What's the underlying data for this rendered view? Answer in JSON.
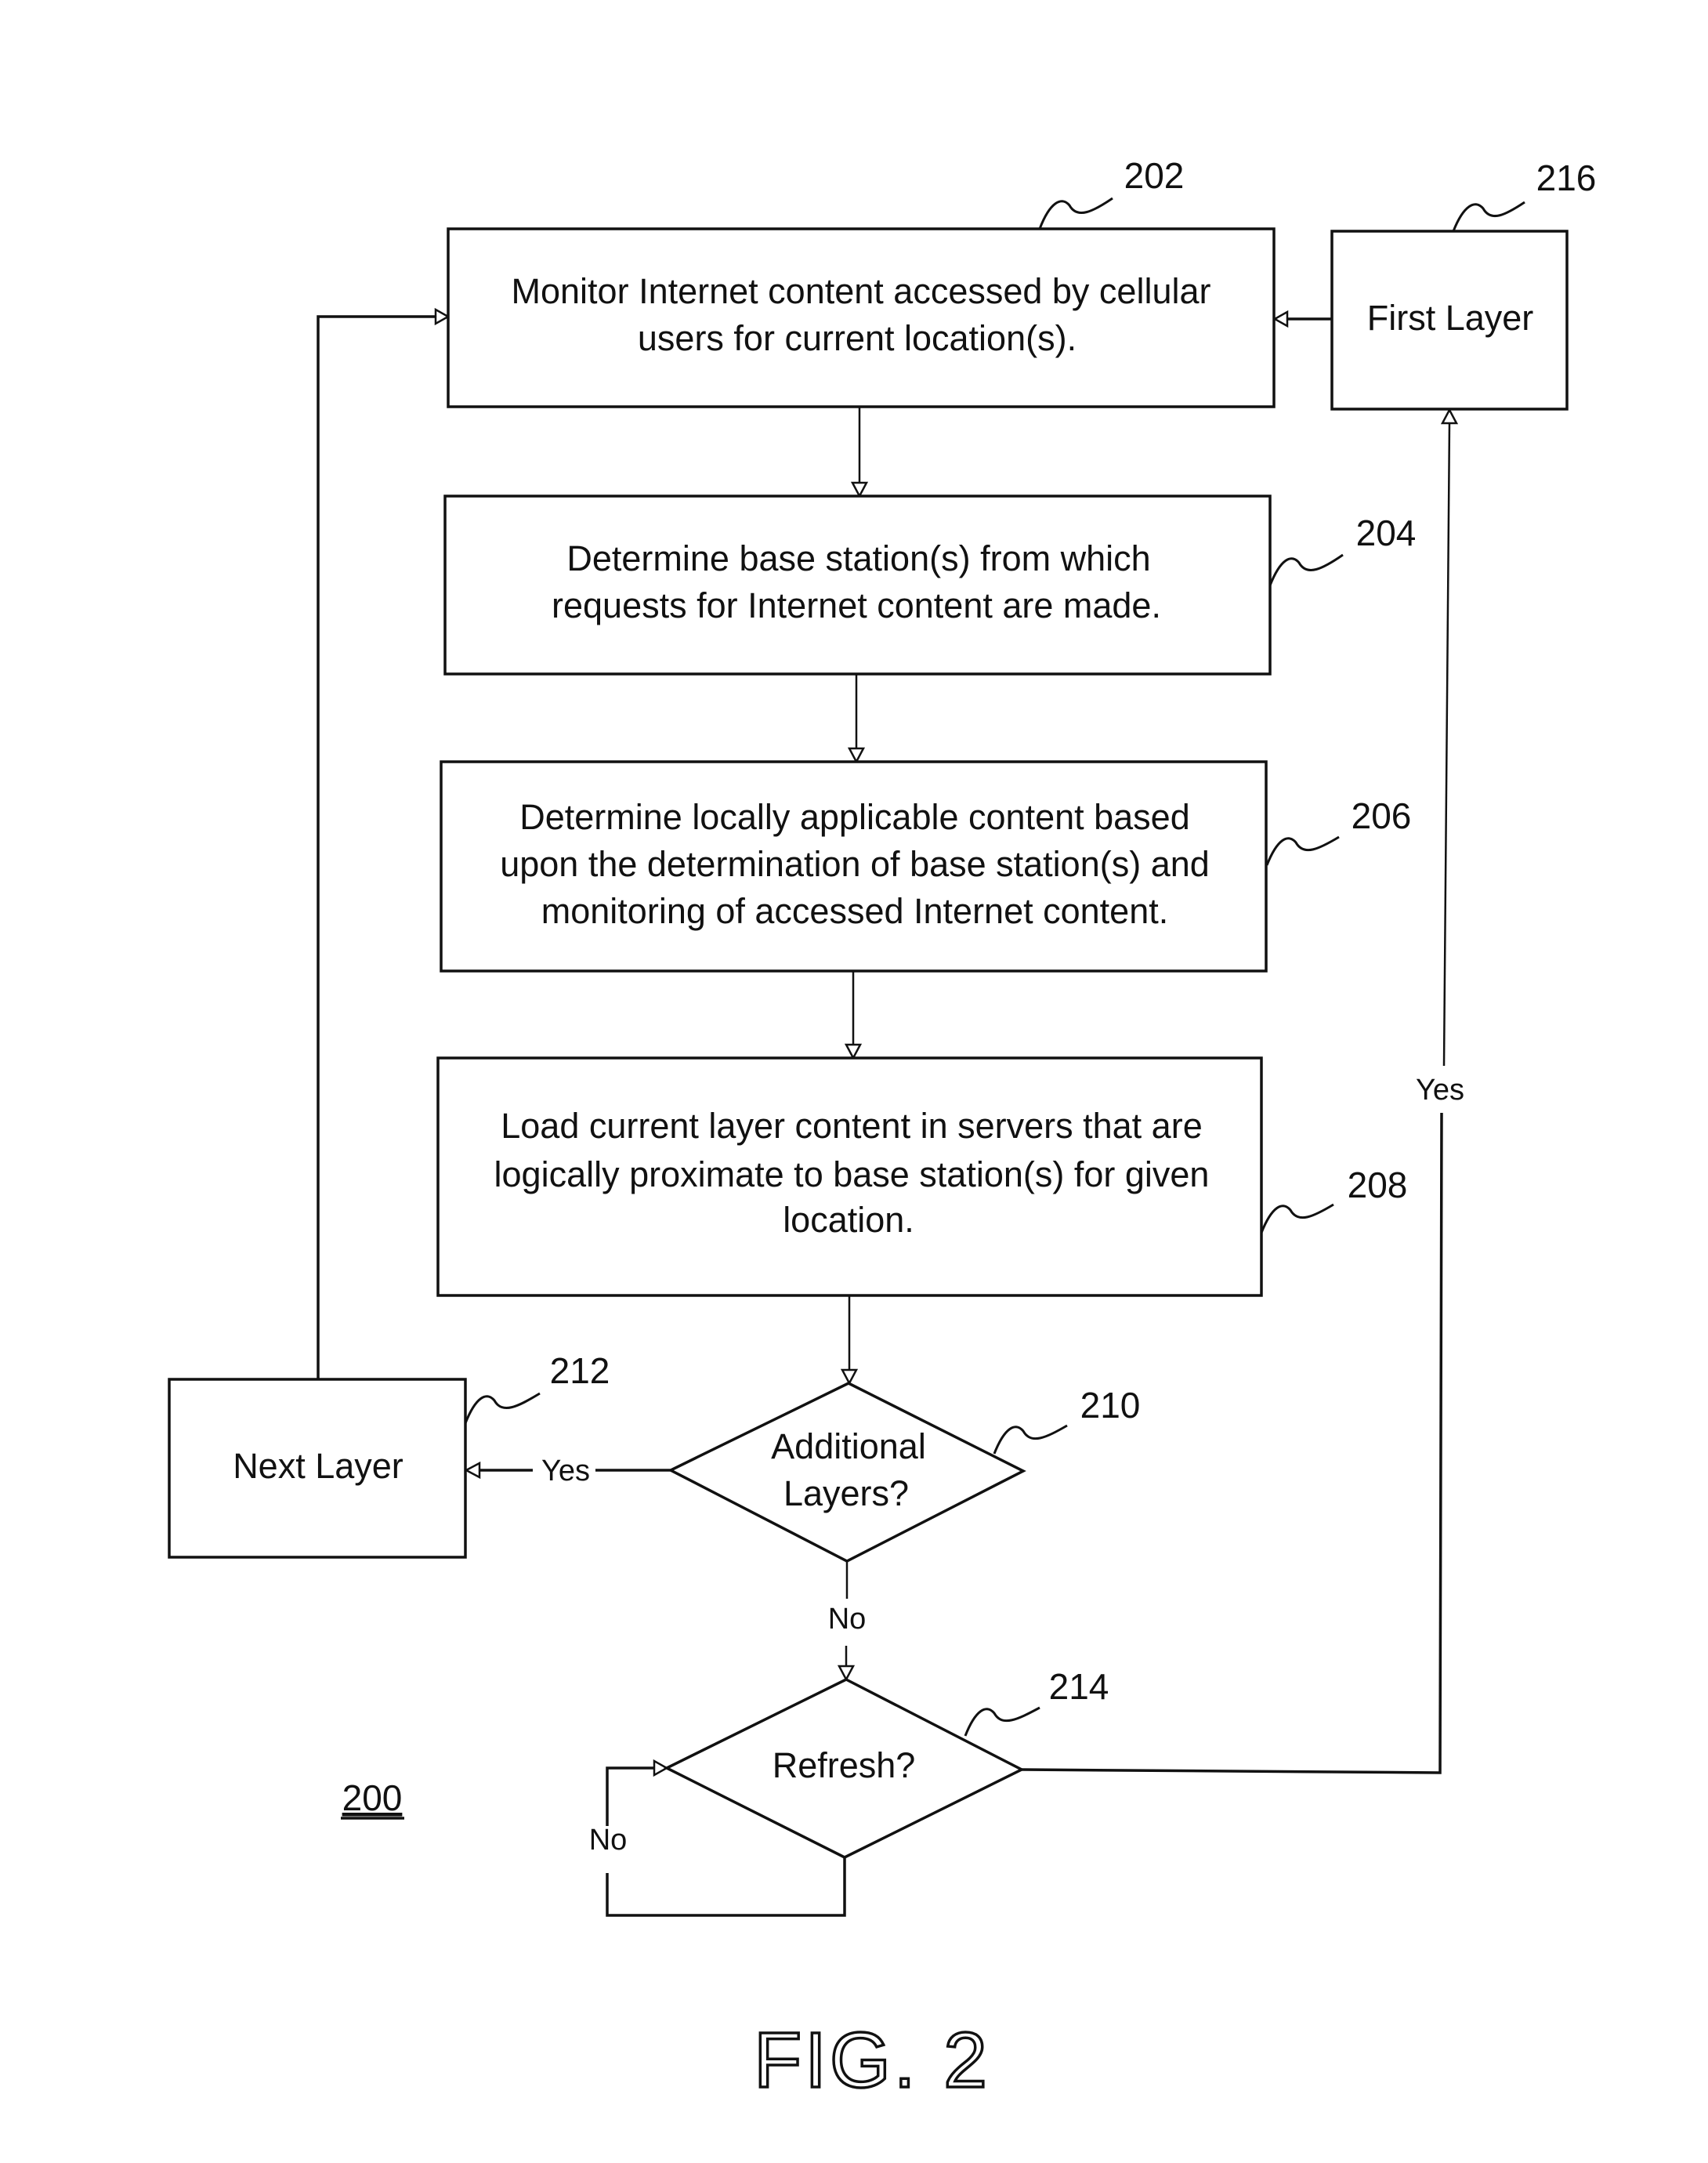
{
  "figure": {
    "title": "FIG. 2",
    "reference": "200"
  },
  "nodes": {
    "n202": {
      "ref": "202",
      "type": "process",
      "lines": [
        "Monitor Internet content accessed by cellular",
        "users for current location(s)."
      ]
    },
    "n204": {
      "ref": "204",
      "type": "process",
      "lines": [
        "Determine base station(s) from which",
        "requests for Internet content are made."
      ]
    },
    "n206": {
      "ref": "206",
      "type": "process",
      "lines": [
        "Determine locally applicable content based",
        "upon the determination of base station(s) and",
        "monitoring of accessed Internet content."
      ]
    },
    "n208": {
      "ref": "208",
      "type": "process",
      "lines": [
        "Load current layer content in servers that are",
        "logically proximate to base station(s) for given",
        "location."
      ]
    },
    "n210": {
      "ref": "210",
      "type": "decision",
      "lines": [
        "Additional",
        "Layers?"
      ]
    },
    "n212": {
      "ref": "212",
      "type": "process",
      "lines": [
        "Next Layer"
      ]
    },
    "n214": {
      "ref": "214",
      "type": "decision",
      "lines": [
        "Refresh?"
      ]
    },
    "n216": {
      "ref": "216",
      "type": "process",
      "lines": [
        "First Layer"
      ]
    }
  },
  "edges": [
    {
      "from": "202",
      "to": "204",
      "label": ""
    },
    {
      "from": "204",
      "to": "206",
      "label": ""
    },
    {
      "from": "206",
      "to": "208",
      "label": ""
    },
    {
      "from": "208",
      "to": "210",
      "label": ""
    },
    {
      "from": "210",
      "to": "212",
      "label": "Yes"
    },
    {
      "from": "212",
      "to": "202",
      "label": ""
    },
    {
      "from": "210",
      "to": "214",
      "label": "No"
    },
    {
      "from": "214",
      "to": "214",
      "label": "No"
    },
    {
      "from": "214",
      "to": "216",
      "label": "Yes"
    },
    {
      "from": "216",
      "to": "202",
      "label": ""
    }
  ],
  "edge_labels": {
    "yes_210_212": "Yes",
    "no_210_214": "No",
    "no_214_loop": "No",
    "yes_214_216": "Yes"
  }
}
